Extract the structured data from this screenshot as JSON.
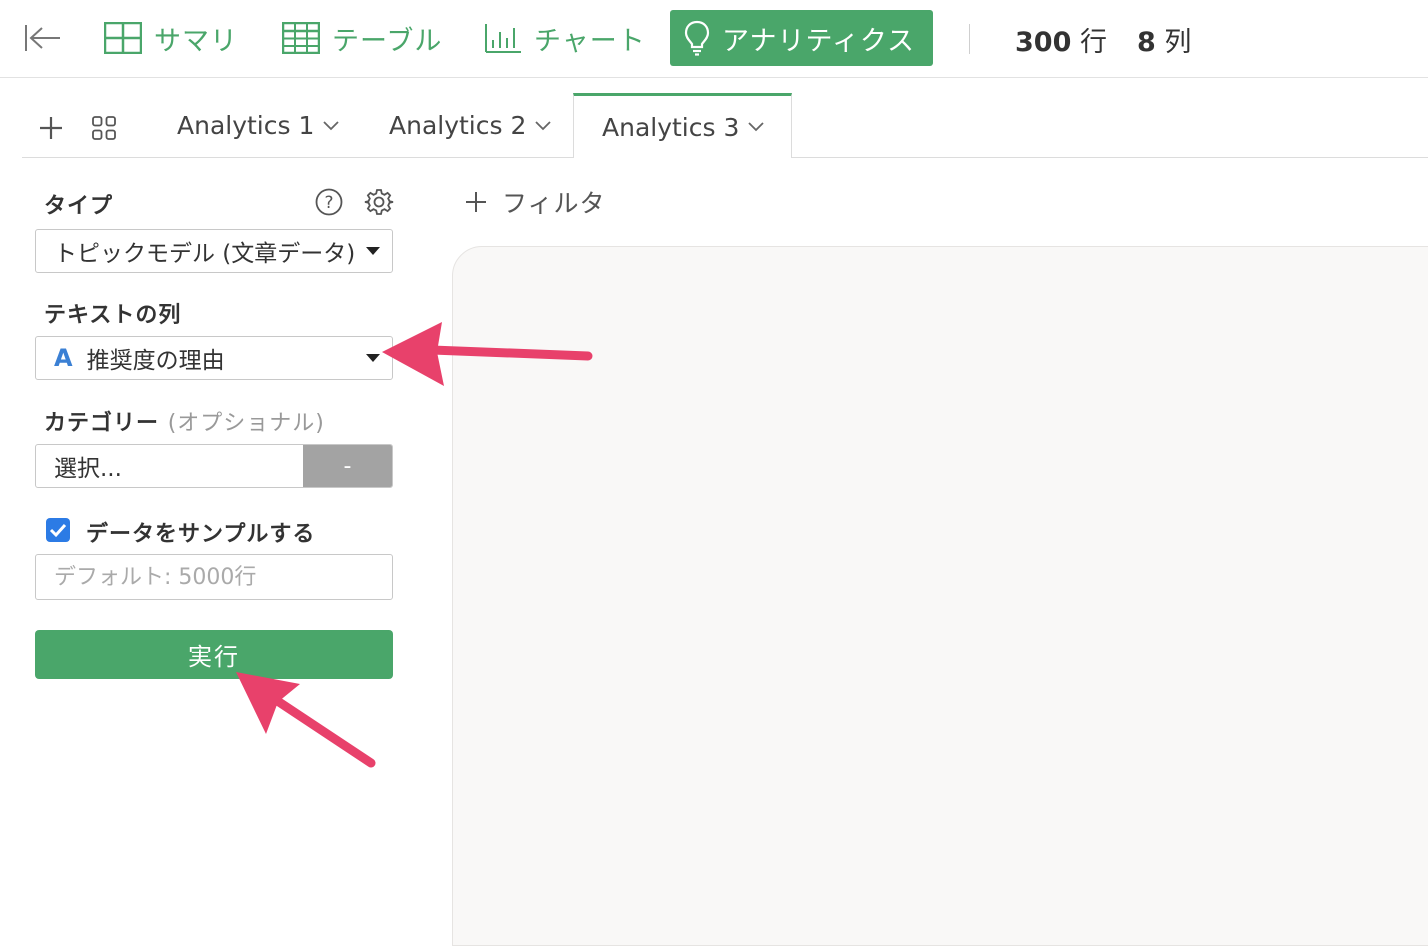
{
  "toolbar": {
    "tabs": [
      {
        "label": "サマリ",
        "icon": "summary-grid-icon"
      },
      {
        "label": "テーブル",
        "icon": "table-icon"
      },
      {
        "label": "チャート",
        "icon": "bar-chart-icon"
      },
      {
        "label": "アナリティクス",
        "icon": "lightbulb-icon",
        "active": true
      }
    ],
    "rows_count": "300",
    "rows_unit": "行",
    "cols_count": "8",
    "cols_unit": "列",
    "accent_color": "#4aa66a"
  },
  "analytics_tabs": [
    {
      "label": "Analytics 1"
    },
    {
      "label": "Analytics 2"
    },
    {
      "label": "Analytics 3",
      "active": true
    }
  ],
  "panel": {
    "type_label": "タイプ",
    "type_value": "トピックモデル (文章データ)",
    "text_column_label": "テキストの列",
    "text_column_value": "推奨度の理由",
    "text_column_type_icon": "A",
    "category_label": "カテゴリー",
    "category_optional": "(オプショナル)",
    "category_placeholder": "選択...",
    "category_button": "-",
    "sample_label": "データをサンプルする",
    "sample_checked": true,
    "sample_placeholder": "デフォルト: 5000行",
    "run_label": "実行"
  },
  "main": {
    "filter_label": "フィルタ"
  },
  "annotation_color": "#e8416b"
}
